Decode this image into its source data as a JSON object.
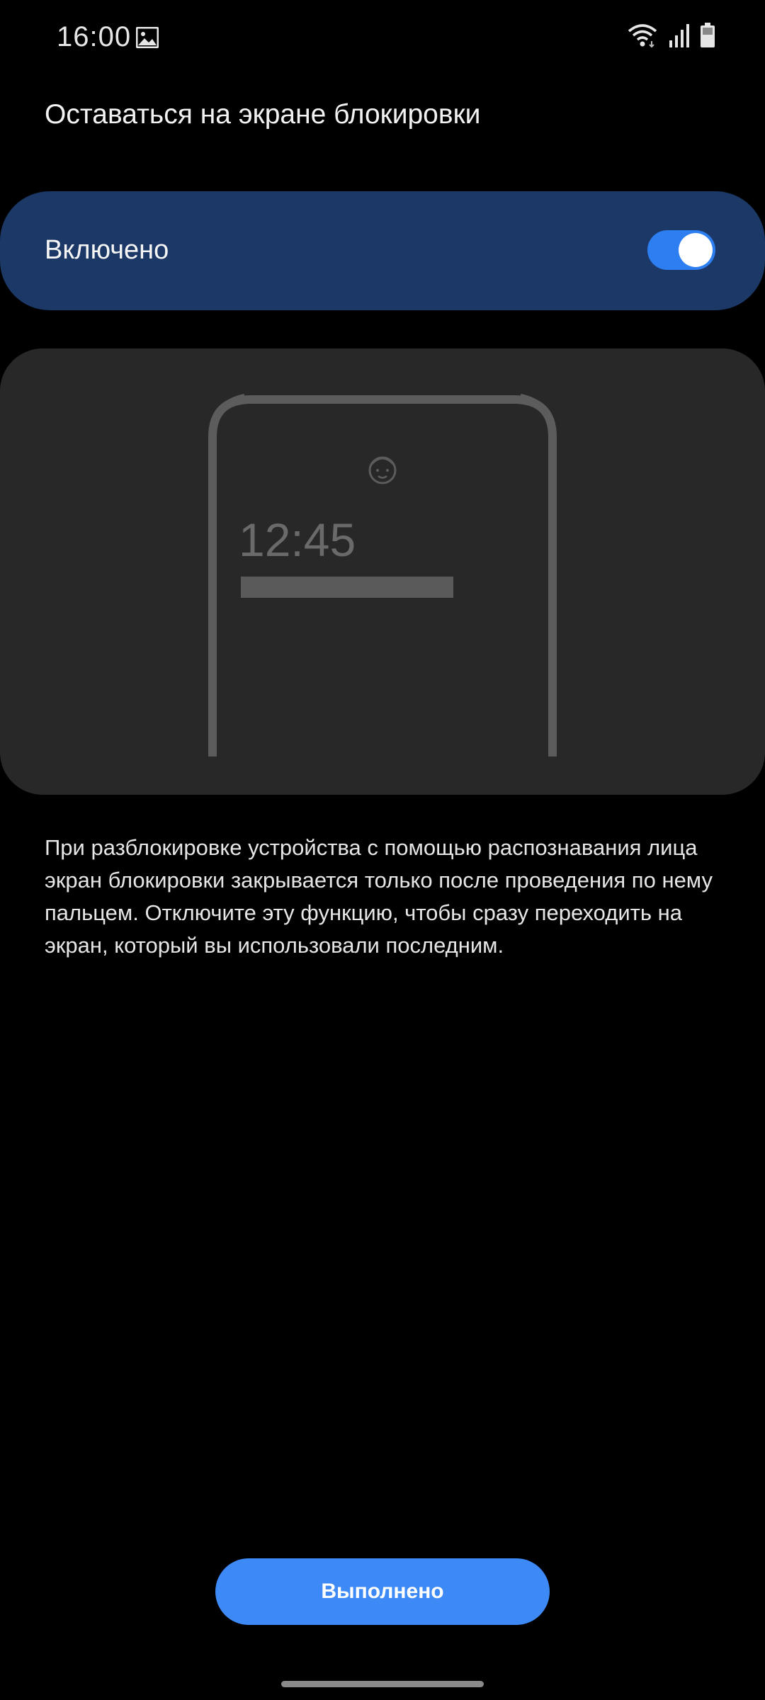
{
  "status_bar": {
    "time": "16:00",
    "icons": [
      "gallery-icon",
      "wifi-icon",
      "signal-icon",
      "battery-icon"
    ]
  },
  "page": {
    "title": "Оставаться на экране блокировки"
  },
  "toggle": {
    "label": "Включено",
    "state": "on"
  },
  "illustration": {
    "clock": "12:45",
    "icon": "face-icon"
  },
  "description": "При разблокировке устройства с помощью распознавания лица экран блокировки закрывается только после проведения по нему пальцем. Отключите эту функцию, чтобы сразу переходить на экран, который вы использовали последним.",
  "done_button": {
    "label": "Выполнено"
  },
  "colors": {
    "background": "#000000",
    "toggle_card": "#1b3866",
    "switch_on": "#2d7ef0",
    "illustration_card": "#282828",
    "button": "#3d8af7"
  }
}
